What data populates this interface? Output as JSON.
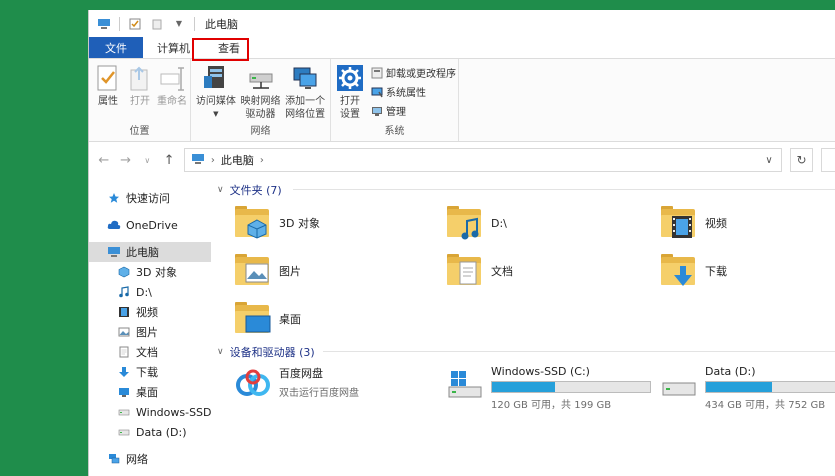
{
  "window": {
    "title": "此电脑"
  },
  "ribbon_tabs": [
    "文件",
    "计算机",
    "查看"
  ],
  "ribbon": {
    "location": {
      "label": "位置",
      "buttons": [
        "属性",
        "打开",
        "重命名"
      ]
    },
    "network": {
      "label": "网络",
      "buttons": [
        {
          "line1": "访问媒体",
          "line2": ""
        },
        {
          "line1": "映射网络",
          "line2": "驱动器"
        },
        {
          "line1": "添加一个",
          "line2": "网络位置"
        }
      ]
    },
    "system": {
      "label": "系统",
      "open_settings": {
        "line1": "打开",
        "line2": "设置"
      },
      "small_items": [
        "卸载或更改程序",
        "系统属性",
        "管理"
      ]
    }
  },
  "address": {
    "path": "此电脑"
  },
  "nav_pane": {
    "items": [
      {
        "label": "快速访问",
        "icon": "star-icon",
        "indent": 0
      },
      {
        "label": "OneDrive",
        "icon": "cloud-icon",
        "indent": 0
      },
      {
        "label": "此电脑",
        "icon": "computer-icon",
        "indent": 0,
        "selected": true
      },
      {
        "label": "3D 对象",
        "icon": "cube-icon",
        "indent": 1
      },
      {
        "label": "D:\\",
        "icon": "music-icon",
        "indent": 1
      },
      {
        "label": "视频",
        "icon": "video-icon",
        "indent": 1
      },
      {
        "label": "图片",
        "icon": "picture-icon",
        "indent": 1
      },
      {
        "label": "文档",
        "icon": "document-icon",
        "indent": 1
      },
      {
        "label": "下载",
        "icon": "download-icon",
        "indent": 1
      },
      {
        "label": "桌面",
        "icon": "desktop-icon",
        "indent": 1
      },
      {
        "label": "Windows-SSD (C",
        "icon": "drive-icon",
        "indent": 1
      },
      {
        "label": "Data (D:)",
        "icon": "drive-icon",
        "indent": 1
      },
      {
        "label": "网络",
        "icon": "network-icon",
        "indent": 0
      }
    ]
  },
  "folders_section": {
    "header": "文件夹 (7)",
    "items": [
      {
        "label": "3D 对象",
        "overlay": "cube"
      },
      {
        "label": "D:\\",
        "overlay": "music"
      },
      {
        "label": "视频",
        "overlay": "video"
      },
      {
        "label": "图片",
        "overlay": "picture"
      },
      {
        "label": "文档",
        "overlay": "document"
      },
      {
        "label": "下载",
        "overlay": "download"
      },
      {
        "label": "桌面",
        "overlay": "desktop"
      }
    ]
  },
  "devices_section": {
    "header": "设备和驱动器 (3)",
    "baidu": {
      "name": "百度网盘",
      "sub": "双击运行百度网盘"
    },
    "drives": [
      {
        "name": "Windows-SSD (C:)",
        "free": "120 GB 可用，共 199 GB",
        "used_fraction": 0.4
      },
      {
        "name": "Data (D:)",
        "free": "434 GB 可用，共 752 GB",
        "used_fraction": 0.42
      }
    ]
  },
  "colors": {
    "file_tab": "#1f5fb8",
    "accent_blue": "#26a0da",
    "highlight_red": "#e00000",
    "section_header": "#1e3287"
  }
}
